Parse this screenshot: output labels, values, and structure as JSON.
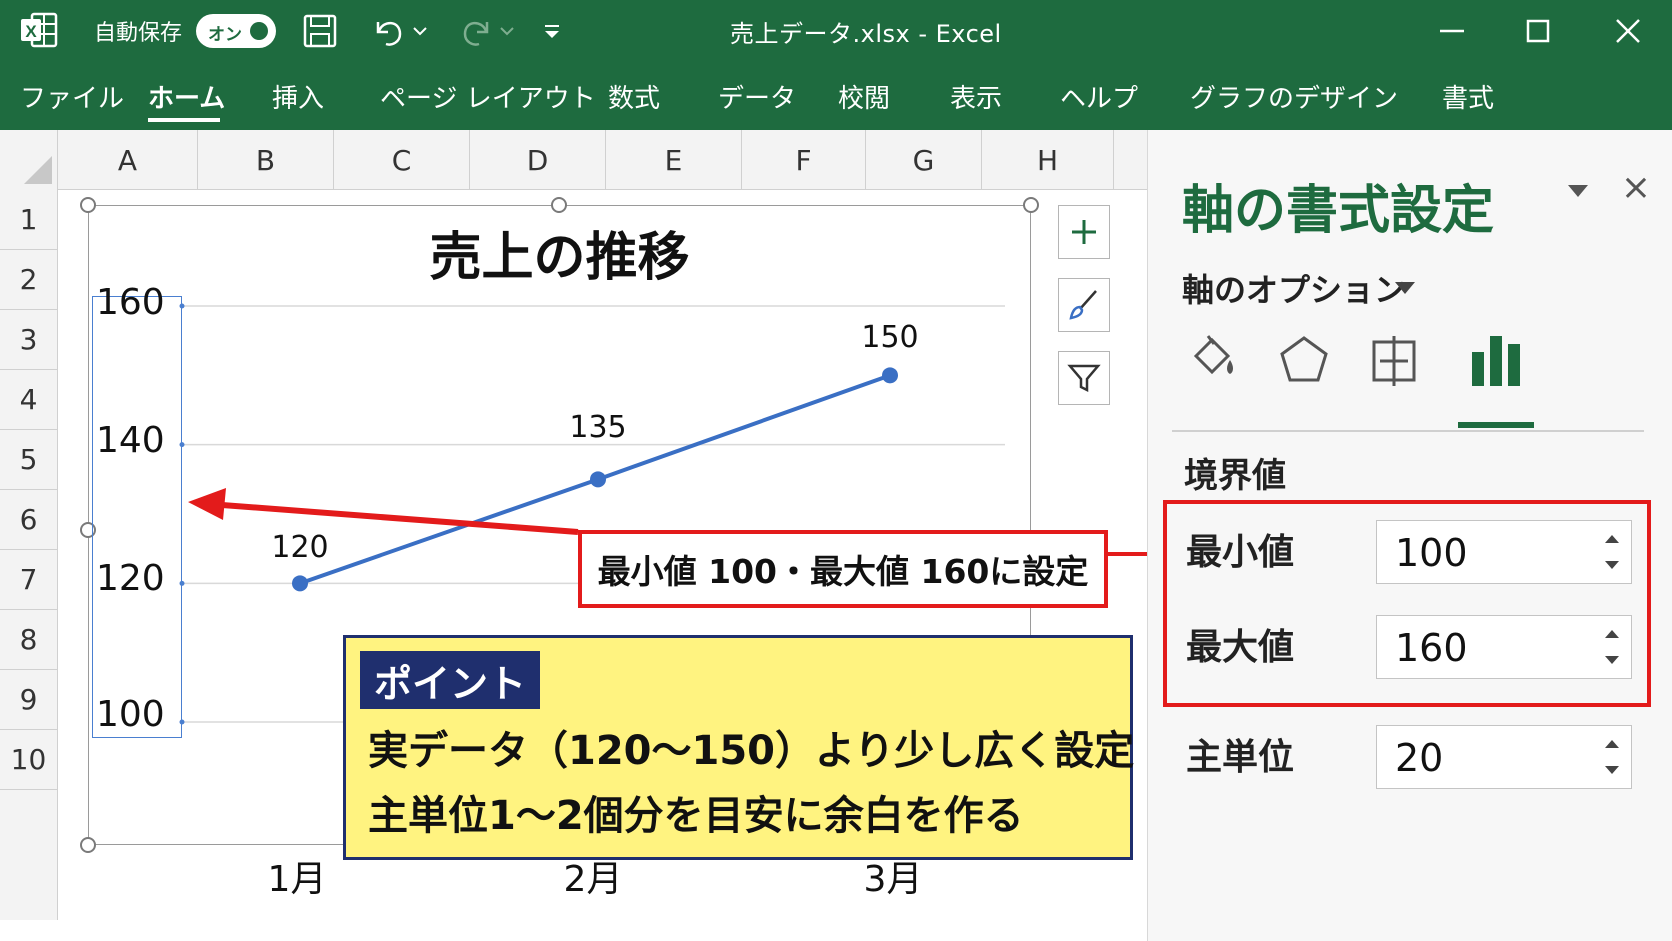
{
  "titlebar": {
    "autosave_label": "自動保存",
    "autosave_state": "オン",
    "title": "売上データ.xlsx  -  Excel"
  },
  "ribbon": {
    "tabs": [
      "ファイル",
      "ホーム",
      "挿入",
      "ページ レイアウト",
      "数式",
      "データ",
      "校閲",
      "表示",
      "ヘルプ",
      "グラフのデザイン",
      "書式"
    ],
    "active_tab": "ホーム"
  },
  "sheet": {
    "columns": [
      "A",
      "B",
      "C",
      "D",
      "E",
      "F",
      "G",
      "H"
    ],
    "rows": [
      "1",
      "2",
      "3",
      "4",
      "5",
      "6",
      "7",
      "8",
      "9",
      "10"
    ]
  },
  "chart_data": {
    "type": "line",
    "title": "売上の推移",
    "categories": [
      "1月",
      "2月",
      "3月"
    ],
    "series": [
      {
        "values": [
          120,
          135,
          150
        ]
      }
    ],
    "data_labels": [
      "120",
      "135",
      "150"
    ],
    "y_ticks": [
      "160",
      "140",
      "120",
      "100"
    ],
    "ylim": [
      100,
      160
    ],
    "y_major_unit": 20,
    "grid": true,
    "line_color": "#3a6fc4"
  },
  "callouts": {
    "axis_note": "最小値 100・最大値 160に設定",
    "point_tag": "ポイント",
    "point_line1": "実データ（120～150）より少し広く設定",
    "point_line2": "主単位1～2個分を目安に余白を作る"
  },
  "pane": {
    "title": "軸の書式設定",
    "subtitle": "軸のオプション",
    "icons": [
      "fill-line-icon",
      "effects-icon",
      "size-properties-icon",
      "axis-options-icon"
    ],
    "section": "境界値",
    "fields": [
      {
        "label": "最小値",
        "value": "100"
      },
      {
        "label": "最大値",
        "value": "160"
      },
      {
        "label": "主単位",
        "value": "20"
      }
    ]
  },
  "colors": {
    "excel_green": "#1e6b3f",
    "highlight_red": "#e31b1b",
    "point_yellow": "#fff380",
    "point_navy": "#1f2f6e"
  }
}
